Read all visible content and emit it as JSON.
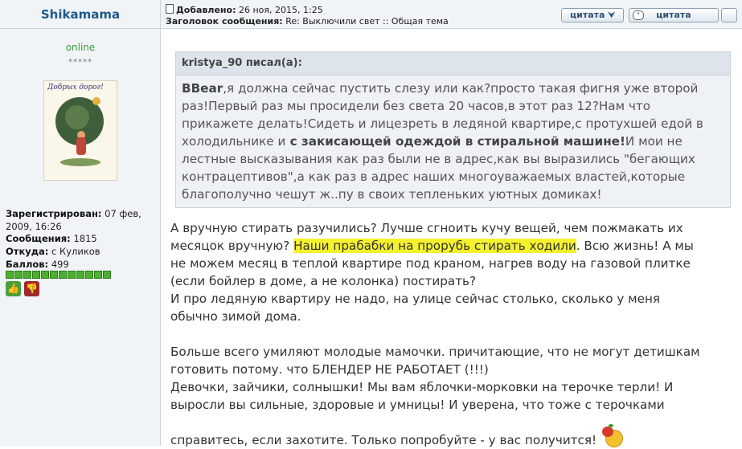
{
  "author": {
    "name": "Shikamama",
    "status": "online",
    "rating_stars": "*****"
  },
  "profile": {
    "registered_label": "Зарегистрирован:",
    "registered_value": "07 фев, 2009, 16:26",
    "posts_label": "Сообщения:",
    "posts_value": "1815",
    "from_label": "Откуда:",
    "from_value": "с Куликов",
    "points_label": "Баллов:",
    "points_value": "499",
    "points_bar_segments": 12,
    "avatar_caption": "Добрых дорог!"
  },
  "post_header": {
    "added_label": "Добавлено:",
    "added_value": "26 ноя, 2015, 1:25",
    "subject_label": "Заголовок сообщения:",
    "subject_value": "Re: Выключили свет :: Общая тема"
  },
  "buttons": {
    "quote_selected": "цитата",
    "quote": "цитата"
  },
  "quote": {
    "author_line": "kristya_90 писал(а):",
    "lines": [
      {
        "bold_prefix": "BBear",
        "text": ",я должна сейчас пустить слезу или как?просто такая фигня уже второй"
      },
      {
        "bold_prefix": "",
        "text": "раз!Первый раз мы просидели без света 20 часов,в этот раз 12?Нам что"
      },
      {
        "bold_prefix": "",
        "text": "прикажете делать!Сидеть и лицезреть в ледяной квартире,с протухшей едой в"
      },
      {
        "bold_prefix": "",
        "text": "холодильнике и",
        "bold_mid": " с закисающей одеждой в стиральной машине!",
        "text_after": "И мои не"
      },
      {
        "bold_prefix": "",
        "text": "лестные высказывания как раз были не в адрес,как вы выразились \"бегающих"
      },
      {
        "bold_prefix": "",
        "text": "контрацептивов\",а как раз в адрес наших многоуважаемых властей,которые"
      },
      {
        "bold_prefix": "",
        "text": "благополучно чешут ж..пу в своих тепленьких уютных домиках!"
      }
    ]
  },
  "message": {
    "p1_line1": "А вручную стирать разучились? Лучше сгноить кучу вещей, чем пожмакать их",
    "p1_line2_pre": "месяцок вручную? ",
    "p1_line2_highlight": "Наши прабабки на прорубь стирать ходили",
    "p1_line2_post": ". Всю жизнь! А мы",
    "p1_line3": "не можем месяц в теплой квартире под краном, нагрев воду на газовой плитке",
    "p1_line4": "(если бойлер в доме, а не колонка) постирать?",
    "p2_line1": "И про ледяную квартиру не надо, на улице сейчас столько, сколько у меня",
    "p2_line2": "обычно зимой дома.",
    "p3_line1": "Больше всего умиляют молодые мамочки. причитающие, что не могут детишкам",
    "p3_line2": "готовить потому. что БЛЕНДЕР НЕ РАБОТАЕТ (!!!)",
    "p4_line1": "Девочки, зайчики, солнышки! Мы вам яблочки-морковки на терочке терли! И",
    "p4_line2": "выросли вы сильные, здоровые и умницы! И уверена, что тоже с терочками",
    "p4_line3": "справитесь, если захотите. Только попробуйте - у вас получится!"
  },
  "colors": {
    "highlight": "#f5f22d",
    "online": "#3a9c3a",
    "author": "#1f5a8a"
  }
}
